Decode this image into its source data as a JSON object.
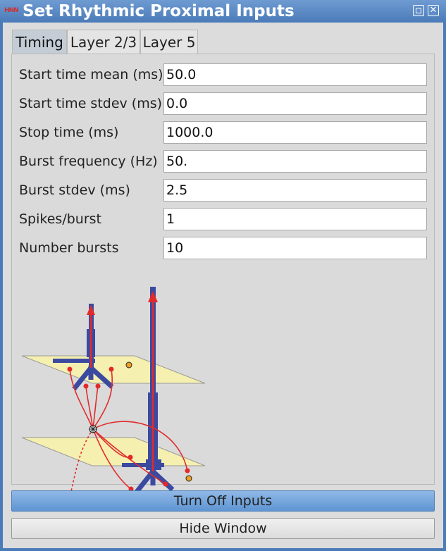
{
  "window": {
    "title": "Set Rhythmic Proximal Inputs",
    "app_icon_text": "HNN",
    "close_glyph": "✕"
  },
  "tabs": [
    {
      "label": "Timing",
      "active": true
    },
    {
      "label": "Layer 2/3",
      "active": false
    },
    {
      "label": "Layer 5",
      "active": false
    }
  ],
  "fields": [
    {
      "label": "Start time mean (ms)",
      "value": "50.0"
    },
    {
      "label": "Start time stdev (ms)",
      "value": "0.0"
    },
    {
      "label": "Stop time (ms)",
      "value": "1000.0"
    },
    {
      "label": "Burst frequency (Hz)",
      "value": "50."
    },
    {
      "label": "Burst stdev (ms)",
      "value": "2.5"
    },
    {
      "label": "Spikes/burst",
      "value": "1"
    },
    {
      "label": "Number bursts",
      "value": "10"
    }
  ],
  "buttons": {
    "turn_off": "Turn Off Inputs",
    "hide": "Hide Window"
  },
  "colors": {
    "title_bar": "#4a7bb8",
    "neuron": "#3b4aa0",
    "axon_arrow": "#e22a2a",
    "layer_plane": "#f5f0b0",
    "orange_dot": "#f0a020"
  }
}
